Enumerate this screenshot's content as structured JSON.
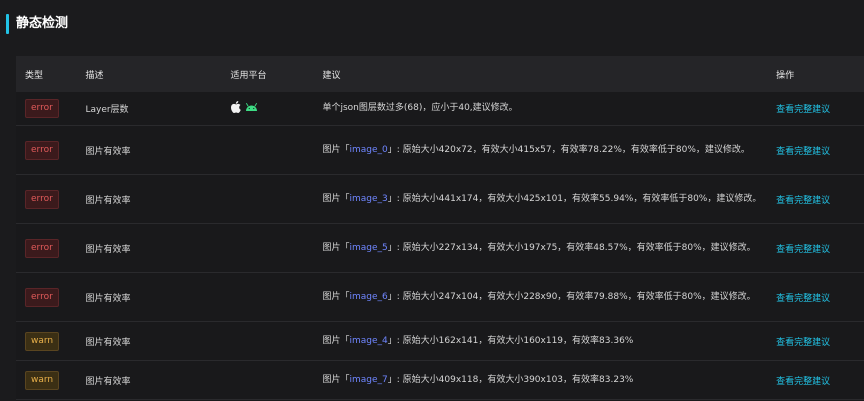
{
  "header": {
    "title": "静态检测"
  },
  "table": {
    "columns": {
      "type": "类型",
      "desc": "描述",
      "platform": "适用平台",
      "advice": "建议",
      "op": "操作"
    },
    "rows": [
      {
        "type": "error",
        "desc": "Layer层数",
        "platform": [
          "apple-icon",
          "android-icon"
        ],
        "advice_pre": "单个json图层数过多(68)，应小于40,建议修改。",
        "image_name": "",
        "advice_post": "",
        "op": "查看完整建议"
      },
      {
        "type": "error",
        "desc": "图片有效率",
        "platform": [],
        "advice_pre": "图片「",
        "image_name": "image_0",
        "advice_post": "」: 原始大小420x72，有效大小415x57，有效率78.22%，有效率低于80%，建议修改。",
        "op": "查看完整建议"
      },
      {
        "type": "error",
        "desc": "图片有效率",
        "platform": [],
        "advice_pre": "图片「",
        "image_name": "image_3",
        "advice_post": "」: 原始大小441x174，有效大小425x101，有效率55.94%，有效率低于80%，建议修改。",
        "op": "查看完整建议"
      },
      {
        "type": "error",
        "desc": "图片有效率",
        "platform": [],
        "advice_pre": "图片「",
        "image_name": "image_5",
        "advice_post": "」: 原始大小227x134，有效大小197x75，有效率48.57%，有效率低于80%，建议修改。",
        "op": "查看完整建议"
      },
      {
        "type": "error",
        "desc": "图片有效率",
        "platform": [],
        "advice_pre": "图片「",
        "image_name": "image_6",
        "advice_post": "」: 原始大小247x104，有效大小228x90，有效率79.88%，有效率低于80%，建议修改。",
        "op": "查看完整建议"
      },
      {
        "type": "warn",
        "desc": "图片有效率",
        "platform": [],
        "advice_pre": "图片「",
        "image_name": "image_4",
        "advice_post": "」: 原始大小162x141，有效大小160x119，有效率83.36%",
        "op": "查看完整建议"
      },
      {
        "type": "warn",
        "desc": "图片有效率",
        "platform": [],
        "advice_pre": "图片「",
        "image_name": "image_7",
        "advice_post": "」: 原始大小409x118，有效大小390x103，有效率83.23%",
        "op": "查看完整建议"
      }
    ]
  },
  "colors": {
    "accent": "#22c3e6",
    "error": "#e05a5a",
    "warn": "#e8b04a",
    "image_link": "#6f86ff",
    "android": "#3ddc84"
  }
}
